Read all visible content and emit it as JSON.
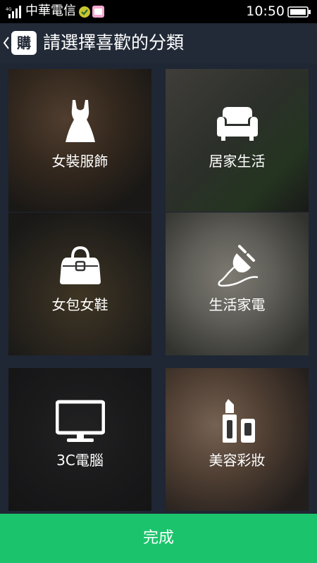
{
  "status_bar": {
    "carrier": "中華電信",
    "time": "10:50",
    "icons": [
      "signal-icon",
      "app-notification-icon",
      "app-notification-icon",
      "battery-icon"
    ]
  },
  "header": {
    "logo_text": "購",
    "title": "請選擇喜歡的分類",
    "back_icon": "chevron-left-icon"
  },
  "categories": [
    {
      "label": "女裝服飾",
      "icon": "dress-icon"
    },
    {
      "label": "居家生活",
      "icon": "sofa-icon"
    },
    {
      "label": "女包女鞋",
      "icon": "handbag-icon"
    },
    {
      "label": "生活家電",
      "icon": "plug-icon"
    },
    {
      "label": "3C電腦",
      "icon": "monitor-icon"
    },
    {
      "label": "美容彩妝",
      "icon": "lipstick-icon"
    }
  ],
  "footer": {
    "done_label": "完成"
  },
  "colors": {
    "background": "#1f2634",
    "done_button": "#1bc46c"
  }
}
